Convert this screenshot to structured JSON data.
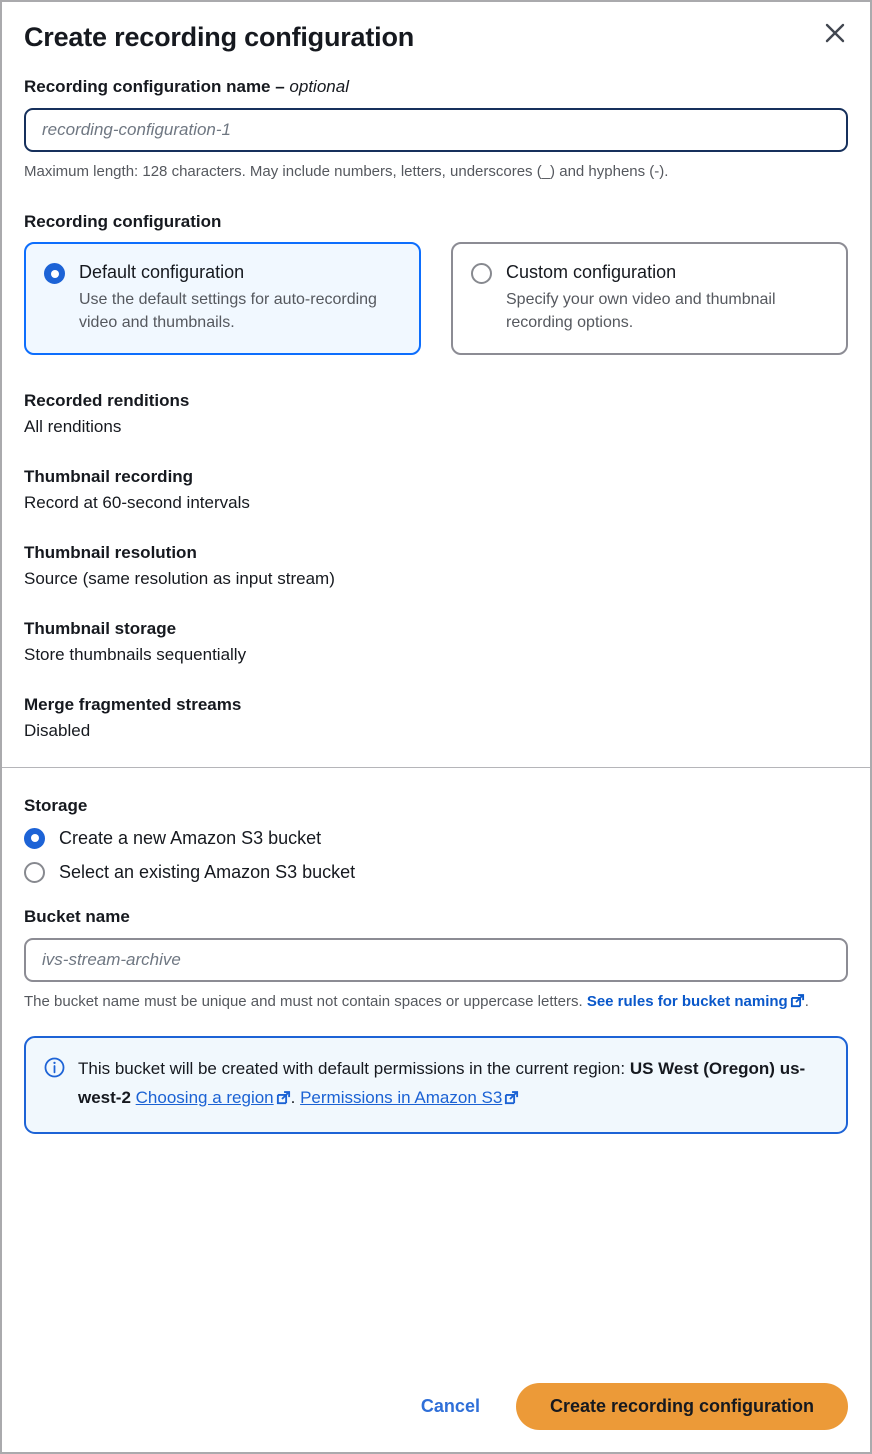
{
  "dialog": {
    "title": "Create recording configuration",
    "close_icon": "close-icon"
  },
  "name_field": {
    "label": "Recording configuration name – ",
    "label_optional": "optional",
    "placeholder": "recording-configuration-1",
    "value": "",
    "hint": "Maximum length: 128 characters. May include numbers, letters, underscores (_) and hyphens (-)."
  },
  "recording_configuration": {
    "label": "Recording configuration",
    "options": [
      {
        "title": "Default configuration",
        "description": "Use the default settings for auto-recording video and thumbnails.",
        "selected": true
      },
      {
        "title": "Custom configuration",
        "description": "Specify your own video and thumbnail recording options.",
        "selected": false
      }
    ]
  },
  "summary": [
    {
      "key": "Recorded renditions",
      "value": "All renditions"
    },
    {
      "key": "Thumbnail recording",
      "value": "Record at 60-second intervals"
    },
    {
      "key": "Thumbnail resolution",
      "value": "Source (same resolution as input stream)"
    },
    {
      "key": "Thumbnail storage",
      "value": "Store thumbnails sequentially"
    },
    {
      "key": "Merge fragmented streams",
      "value": "Disabled"
    }
  ],
  "storage": {
    "label": "Storage",
    "options": [
      {
        "label": "Create a new Amazon S3 bucket",
        "selected": true
      },
      {
        "label": "Select an existing Amazon S3 bucket",
        "selected": false
      }
    ]
  },
  "bucket_field": {
    "label": "Bucket name",
    "placeholder": "ivs-stream-archive",
    "value": "",
    "hint_text": "The bucket name must be unique and must not contain spaces or uppercase letters. ",
    "hint_link": "See rules for bucket naming",
    "hint_suffix": "."
  },
  "info_alert": {
    "icon": "info-icon",
    "text_start": "This bucket will be created with default permissions in the current region: ",
    "region": "US West (Oregon) us-west-2",
    "link_region": "Choosing a region",
    "separator": ". ",
    "link_permissions": "Permissions in Amazon S3"
  },
  "footer": {
    "cancel_label": "Cancel",
    "submit_label": "Create recording configuration"
  },
  "colors": {
    "accent_blue": "#1d63d6",
    "link_blue": "#0a58ca",
    "primary_orange": "#ec9a38",
    "selected_card_bg": "#f1f8ff",
    "alert_bg": "#f1f8fd",
    "border_gray": "#8c8c94",
    "text_dark": "#16191f",
    "text_muted": "#55585e"
  }
}
